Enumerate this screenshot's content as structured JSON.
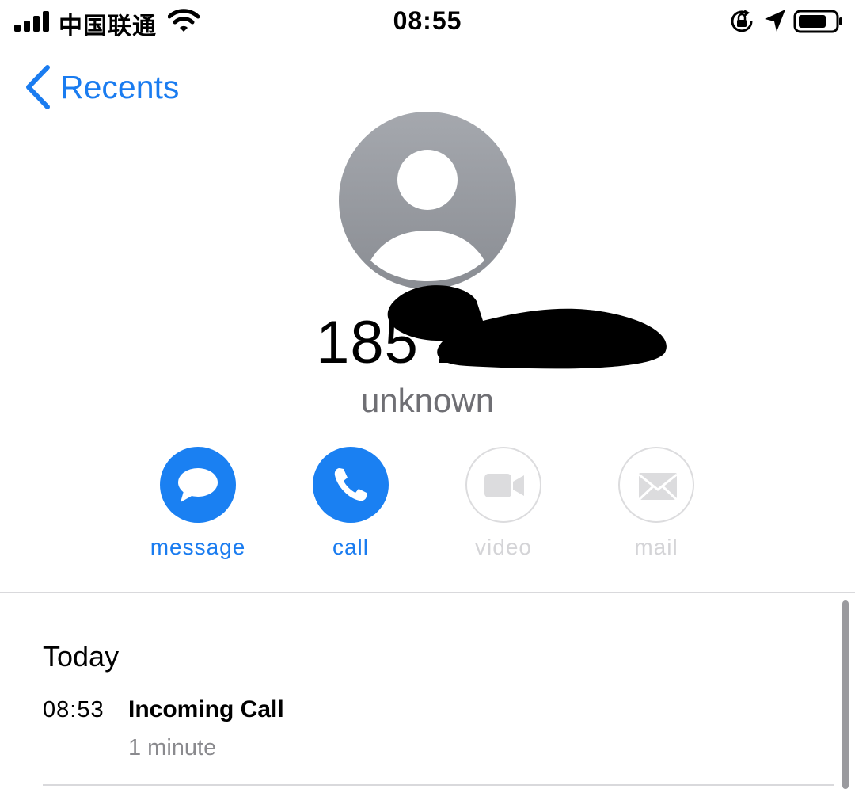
{
  "status_bar": {
    "carrier": "中国联通",
    "time": "08:55",
    "icons": [
      "cellular-signal-icon",
      "wifi-icon",
      "orientation-lock-icon",
      "location-arrow-icon",
      "battery-icon"
    ]
  },
  "nav": {
    "back_label": "Recents",
    "back_icon": "chevron-left-icon"
  },
  "contact": {
    "number_visible": "185 224",
    "number_redacted": true,
    "label": "unknown",
    "avatar_icon": "person-silhouette-icon"
  },
  "actions": [
    {
      "label": "message",
      "icon": "message-bubble-icon",
      "enabled": true
    },
    {
      "label": "call",
      "icon": "phone-icon",
      "enabled": true
    },
    {
      "label": "video",
      "icon": "video-camera-icon",
      "enabled": false
    },
    {
      "label": "mail",
      "icon": "envelope-icon",
      "enabled": false
    }
  ],
  "history": {
    "section_title": "Today",
    "entries": [
      {
        "time": "08:53",
        "type": "Incoming Call",
        "duration": "1 minute"
      }
    ]
  },
  "colors": {
    "accent": "#1a80f2",
    "disabled": "#d4d4d7",
    "secondary_text": "#8a8a8e"
  }
}
